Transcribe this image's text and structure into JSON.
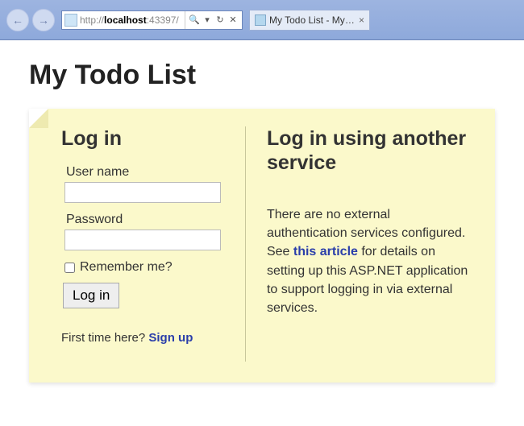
{
  "browser": {
    "url_prefix": "http://",
    "url_host": "localhost",
    "url_port": ":43397/",
    "tab_title": "My Todo List - My A..."
  },
  "page": {
    "title": "My Todo List"
  },
  "login": {
    "heading": "Log in",
    "username_label": "User name",
    "username_value": "",
    "password_label": "Password",
    "password_value": "",
    "remember_label": "Remember me?",
    "submit_label": "Log in",
    "signup_prompt": "First time here? ",
    "signup_link": "Sign up"
  },
  "external": {
    "heading": "Log in using another service",
    "text_before": "There are no external authentication services configured. See ",
    "link_text": "this article",
    "text_after": " for details on setting up this ASP.NET application to support logging in via external services."
  }
}
